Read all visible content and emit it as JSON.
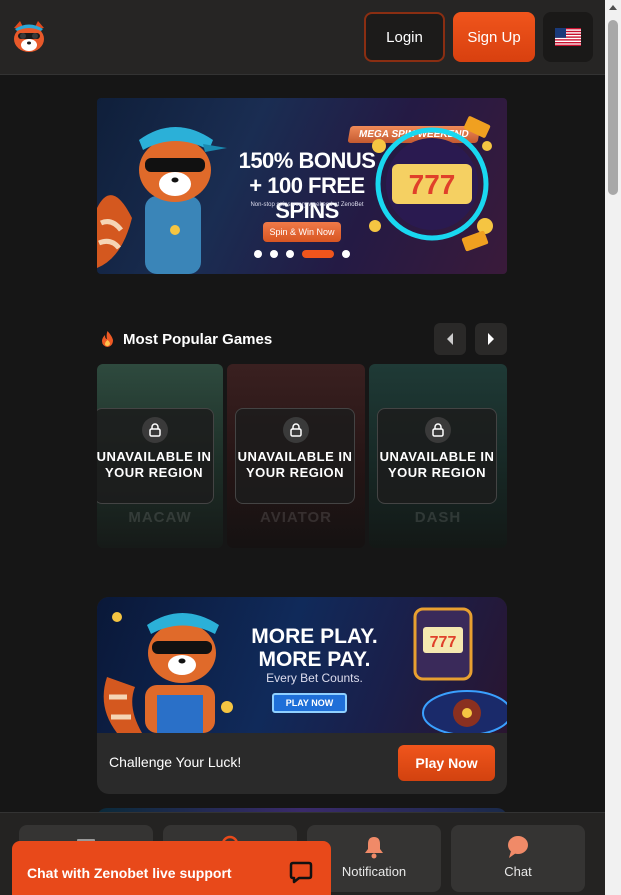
{
  "header": {
    "login_label": "Login",
    "signup_label": "Sign Up",
    "language_flag": "us-flag-icon"
  },
  "hero": {
    "tag": "MEGA SPIN WEEKEND",
    "title": "150% BONUS + 100 FREE SPINS",
    "subtitle": "Non-stop spins every weekend at ZenoBet",
    "cta": "Spin & Win Now",
    "slides_total": 5,
    "active_slide": 4
  },
  "popular": {
    "title": "Most Popular Games",
    "icon": "fire-icon",
    "games": [
      {
        "name": "MACAW",
        "status": "UNAVAILABLE IN YOUR REGION"
      },
      {
        "name": "AVIATOR",
        "status": "UNAVAILABLE IN YOUR REGION"
      },
      {
        "name": "DASH",
        "status": "UNAVAILABLE IN YOUR REGION"
      }
    ]
  },
  "promo": {
    "headline": "MORE PLAY. MORE PAY.",
    "subline": "Every Bet Counts.",
    "image_button": "PLAY NOW",
    "text": "Challenge Your Luck!",
    "button": "Play Now"
  },
  "bottom_nav": {
    "items": [
      {
        "label": "",
        "icon": "menu-icon"
      },
      {
        "label": "",
        "icon": "games-icon"
      },
      {
        "label": "Notification",
        "icon": "bell-icon"
      },
      {
        "label": "Chat",
        "icon": "chat-icon"
      }
    ]
  },
  "chat_support": {
    "label": "Chat with Zenobet live support",
    "icon": "chat-bubble-icon"
  },
  "colors": {
    "accent": "#f0551c",
    "background": "#161616",
    "header": "#262524"
  }
}
